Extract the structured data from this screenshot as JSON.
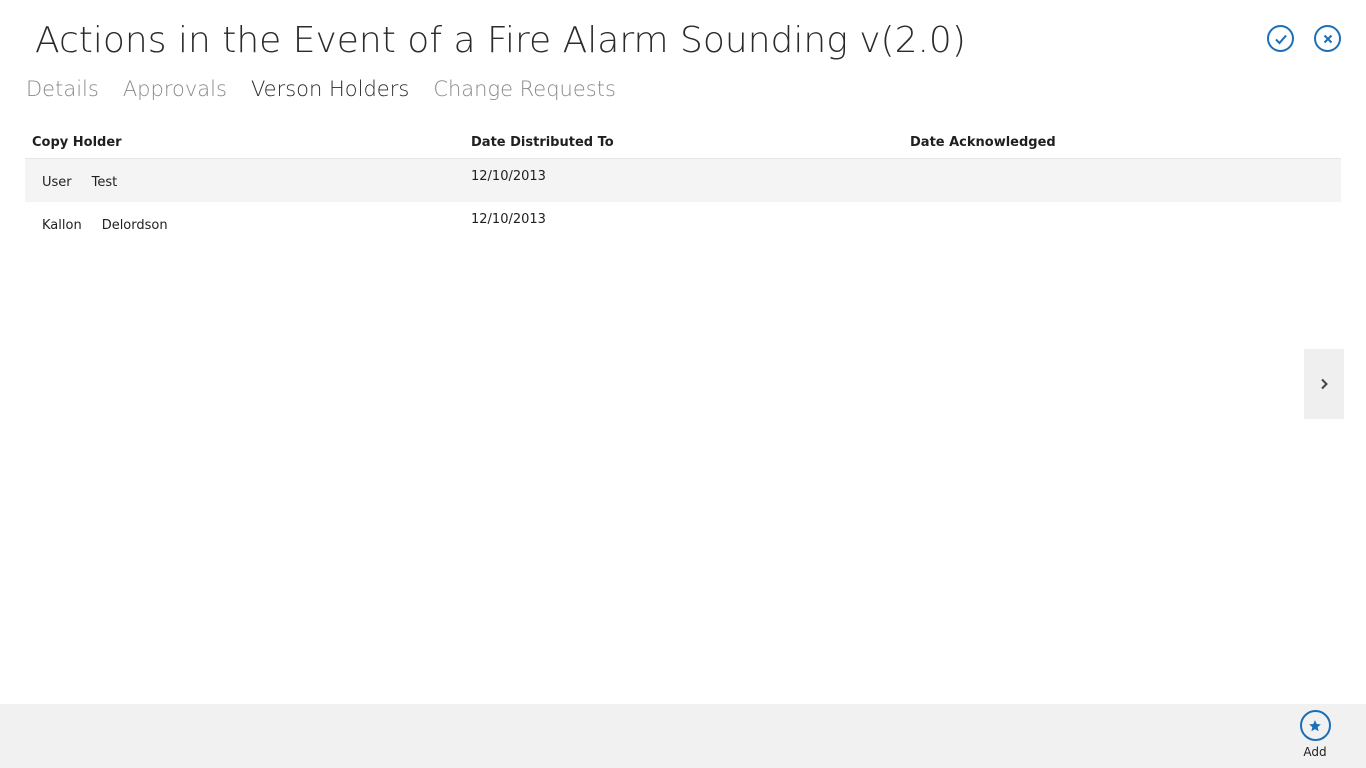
{
  "header": {
    "title": "Actions in the Event of a Fire Alarm Sounding v(2.0)",
    "accept_icon": "checkmark-icon",
    "close_icon": "close-icon"
  },
  "tabs": [
    {
      "label": "Details",
      "active": false
    },
    {
      "label": "Approvals",
      "active": false
    },
    {
      "label": "Verson Holders",
      "active": true
    },
    {
      "label": "Change Requests",
      "active": false
    }
  ],
  "grid": {
    "columns": [
      "Copy Holder",
      "Date Distributed To",
      "Date Acknowledged"
    ],
    "rows": [
      {
        "first_name": "User",
        "last_name": "Test",
        "date_distributed": "12/10/2013",
        "date_acknowledged": ""
      },
      {
        "first_name": "Kallon",
        "last_name": "Delordson",
        "date_distributed": "12/10/2013",
        "date_acknowledged": ""
      }
    ]
  },
  "navigation": {
    "next_icon": "chevron-right-icon"
  },
  "appbar": {
    "add_label": "Add",
    "add_icon": "star-icon"
  },
  "colors": {
    "accent": "#1b6fb8",
    "row_alt": "#f4f4f4",
    "appbar_bg": "#f1f1f1"
  }
}
